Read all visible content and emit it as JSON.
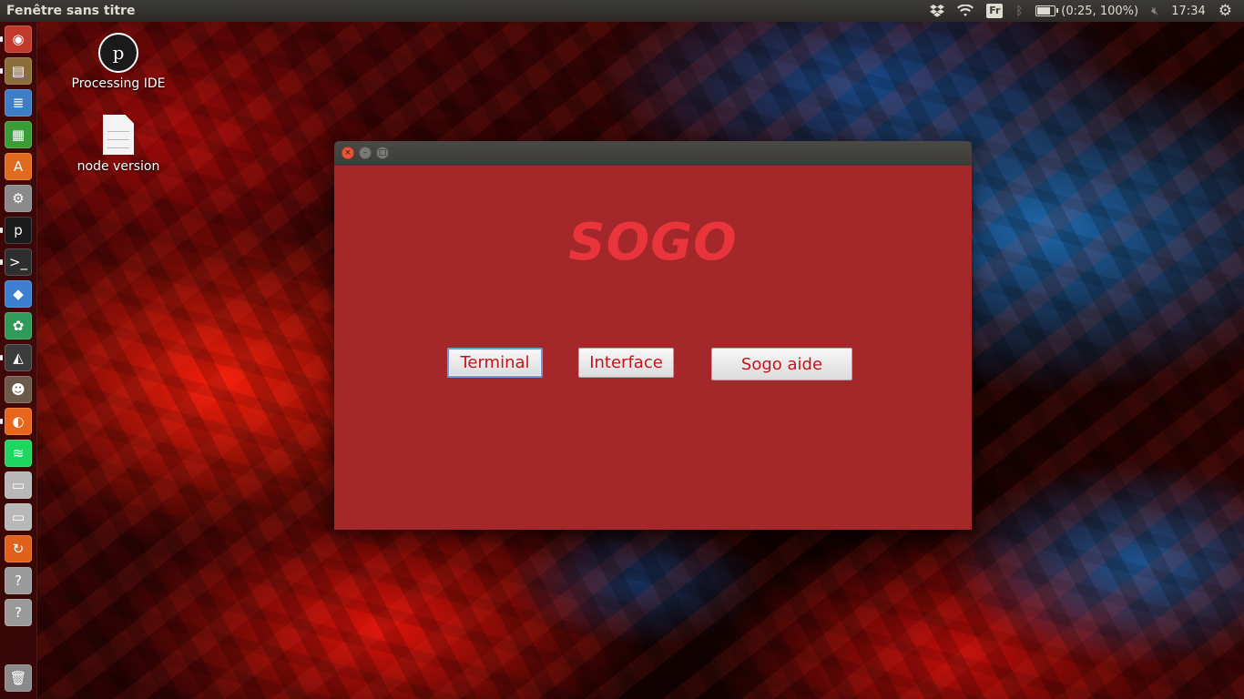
{
  "top_panel": {
    "window_title": "Fenêtre sans titre",
    "keyboard_layout": "Fr",
    "battery": {
      "text": "(0:25, 100%)",
      "level_percent": 100
    },
    "clock": "17:34",
    "icons": [
      "dropbox-icon",
      "wifi-icon",
      "keyboard-layout-icon",
      "bluetooth-icon",
      "battery-icon",
      "volume-muted-icon",
      "settings-gear-icon"
    ]
  },
  "launcher": {
    "items": [
      {
        "name": "ubuntu-dash",
        "glyph": "◉",
        "color": "#c0392b"
      },
      {
        "name": "files",
        "glyph": "▤",
        "color": "#8a6d3b"
      },
      {
        "name": "libreoffice-writer",
        "glyph": "≣",
        "color": "#3d7ec6"
      },
      {
        "name": "libreoffice-calc",
        "glyph": "▦",
        "color": "#3a9d3a"
      },
      {
        "name": "software-center",
        "glyph": "A",
        "color": "#e06a1e"
      },
      {
        "name": "system-settings",
        "glyph": "⚙",
        "color": "#8a8a8a"
      },
      {
        "name": "processing",
        "glyph": "p",
        "color": "#1a1a1a"
      },
      {
        "name": "terminal",
        "glyph": ">_",
        "color": "#2e2e2e"
      },
      {
        "name": "dropbox",
        "glyph": "◆",
        "color": "#3a7fd0"
      },
      {
        "name": "mind-map",
        "glyph": "✿",
        "color": "#2f9a5a"
      },
      {
        "name": "unity-editor",
        "glyph": "◭",
        "color": "#3b3b3b"
      },
      {
        "name": "gimp",
        "glyph": "☻",
        "color": "#6b5a4a"
      },
      {
        "name": "firefox",
        "glyph": "◐",
        "color": "#e8661c"
      },
      {
        "name": "spotify",
        "glyph": "≋",
        "color": "#1ed760"
      },
      {
        "name": "drive-1",
        "glyph": "▭",
        "color": "#b8b8b8"
      },
      {
        "name": "drive-2",
        "glyph": "▭",
        "color": "#b8b8b8"
      },
      {
        "name": "software-updater",
        "glyph": "↻",
        "color": "#e0601c"
      },
      {
        "name": "unknown-app-1",
        "glyph": "?",
        "color": "#9a9a9a"
      },
      {
        "name": "unknown-app-2",
        "glyph": "?",
        "color": "#9a9a9a"
      },
      {
        "name": "trash",
        "glyph": "🗑",
        "color": "#8a8a8a"
      }
    ]
  },
  "desktop": {
    "icons": [
      {
        "label": "Processing IDE"
      },
      {
        "label": "node version"
      }
    ]
  },
  "window": {
    "heading": "SOGO",
    "buttons": {
      "terminal": "Terminal",
      "interface": "Interface",
      "help": "Sogo aide"
    },
    "controls": {
      "close": "×",
      "minimize": "–",
      "maximize": "□"
    },
    "colors": {
      "background": "#a4282a",
      "heading": "#e8343a",
      "button_text": "#c0151c"
    }
  }
}
